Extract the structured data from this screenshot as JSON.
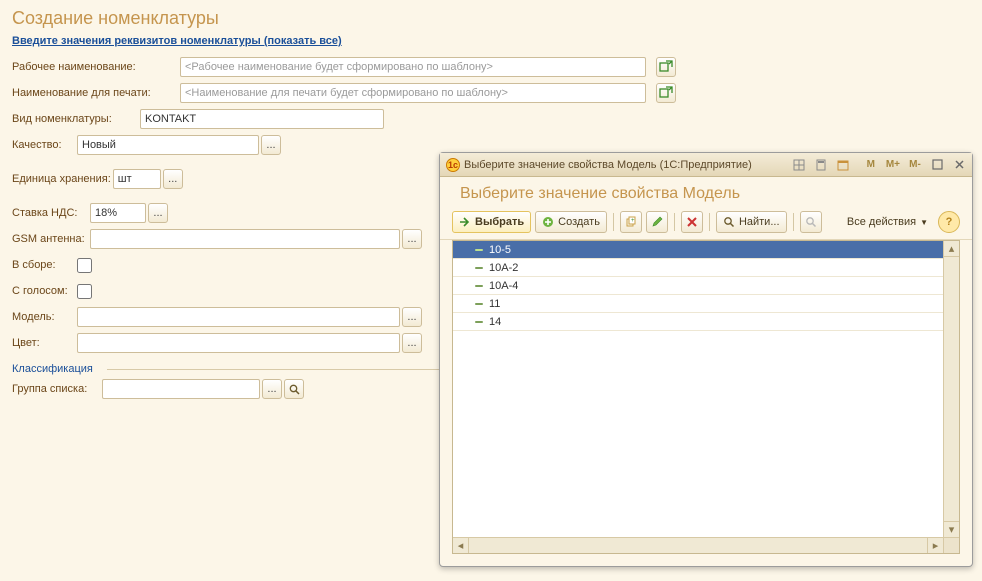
{
  "page": {
    "title": "Создание номенклатуры",
    "show_all_link": "Введите значения реквизитов номенклатуры (показать все)"
  },
  "form": {
    "working_name": {
      "label": "Рабочее наименование:",
      "placeholder": "<Рабочее наименование будет сформировано по шаблону>"
    },
    "print_name": {
      "label": "Наименование для печати:",
      "placeholder": "<Наименование для печати будет сформировано по шаблону>"
    },
    "kind": {
      "label": "Вид номенклатуры:",
      "value": "KONTAKT"
    },
    "quality": {
      "label": "Качество:",
      "value": "Новый"
    },
    "storage_unit": {
      "label": "Единица хранения:",
      "value": "шт"
    },
    "vat": {
      "label": "Ставка НДС:",
      "value": "18%"
    },
    "gsm": {
      "label": "GSM антенна:"
    },
    "assembled": {
      "label": "В сборе:"
    },
    "voice": {
      "label": "С голосом:"
    },
    "model": {
      "label": "Модель:"
    },
    "color": {
      "label": "Цвет:"
    },
    "classification_hdr": "Классификация",
    "list_group": {
      "label": "Группа списка:"
    }
  },
  "dialog": {
    "titlebar": "Выберите значение свойства Модель  (1С:Предприятие)",
    "heading": "Выберите значение свойства Модель",
    "toolbar": {
      "select": "Выбрать",
      "create": "Создать",
      "find": "Найти...",
      "all_actions": "Все действия"
    },
    "memory_buttons": {
      "m": "M",
      "mplus": "M+",
      "mminus": "M-"
    },
    "items": [
      "10-5",
      "10A-2",
      "10A-4",
      "11",
      "14"
    ],
    "selected_index": 0
  }
}
